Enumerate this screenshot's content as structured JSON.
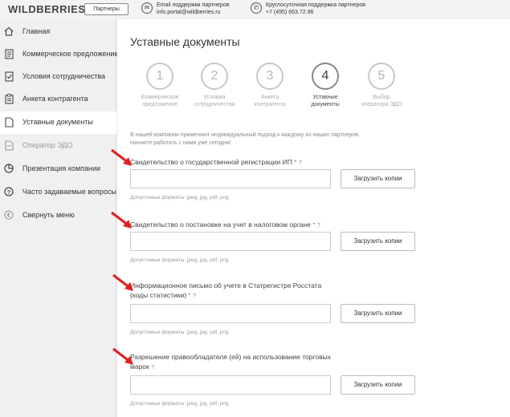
{
  "header": {
    "logo": "WILDBERRIES",
    "badge": "Партнеры",
    "email_title": "Email поддержки партнеров",
    "email_value": "info.portal@wildberries.ru",
    "phone_title": "Круглосуточная поддержка партнеров",
    "phone_value": "+7 (495) 663.72.96"
  },
  "sidebar": {
    "items": [
      {
        "label": "Главная",
        "icon": "home-icon"
      },
      {
        "label": "Коммерческое предложение",
        "icon": "document-icon"
      },
      {
        "label": "Условия сотрудничества",
        "icon": "checklist-icon"
      },
      {
        "label": "Анкета контрагента",
        "icon": "clipboard-icon"
      },
      {
        "label": "Уставные документы",
        "icon": "file-icon"
      },
      {
        "label": "Оператор ЭДО",
        "icon": "edo-icon"
      },
      {
        "label": "Презентация компании",
        "icon": "pie-chart-icon"
      },
      {
        "label": "Часто задаваемые вопросы",
        "icon": "question-icon"
      },
      {
        "label": "Свернуть меню",
        "icon": "collapse-icon"
      }
    ]
  },
  "main": {
    "title": "Уставные документы",
    "steps": [
      {
        "number": "1",
        "label_1": "Коммерческое",
        "label_2": "предложение"
      },
      {
        "number": "2",
        "label_1": "Условия",
        "label_2": "сотрудничества"
      },
      {
        "number": "3",
        "label_1": "Анкета",
        "label_2": "контрагента"
      },
      {
        "number": "4",
        "label_1": "Уставные",
        "label_2": "документы"
      },
      {
        "number": "5",
        "label_1": "Выбор",
        "label_2": "оператора ЭДО"
      }
    ],
    "intro_1": "В нашей компании применяют индивидуальный подход к каждому из наших партнеров.",
    "intro_2": "Начните работать с нами уже сегодня!",
    "fields": [
      {
        "label_1": "Свидетельство о государственной регистрации ИП",
        "label_2": "",
        "required": "*",
        "help": "?",
        "button": "Загрузить копии",
        "formats": "Допустимые форматы: jpeg, jpg, pdf, png"
      },
      {
        "label_1": "Свидетельство о постановке на учет в налоговом органе",
        "label_2": "",
        "required": "*",
        "help": "?",
        "button": "Загрузить копии",
        "formats": "Допустимые форматы: jpeg, jpg, pdf, png"
      },
      {
        "label_1": "Информационное письмо об учете в Статрегистре Росстата",
        "label_2": "(коды статистики)",
        "required": "*",
        "help": "?",
        "button": "Загрузить копии",
        "formats": "Допустимые форматы: jpeg, jpg, pdf, png"
      },
      {
        "label_1": "Разрешение правообладателя (ей) на использование торговых",
        "label_2": "марок",
        "required": "",
        "help": "?",
        "button": "Загрузить копии",
        "formats": "Допустимые форматы: jpeg, jpg, pdf, png"
      }
    ]
  },
  "colors": {
    "arrow": "#e02020",
    "active_step": "#888888",
    "inactive_step": "#c8c8c8"
  }
}
